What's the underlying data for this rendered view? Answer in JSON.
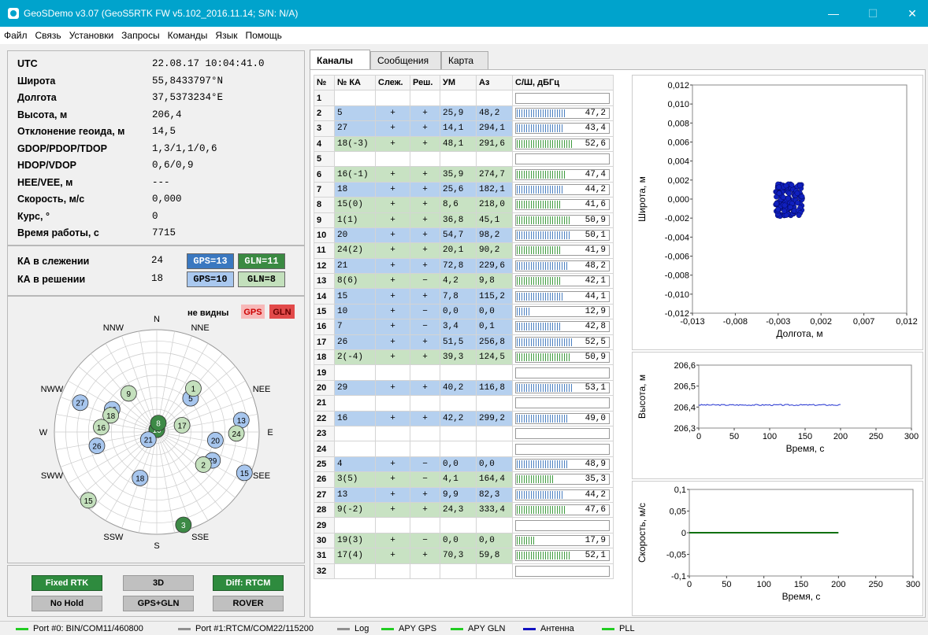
{
  "window": {
    "title": "GeoSDemo v3.07 (GeoS5RTK FW v5.102_2016.11.14; S/N: N/A)",
    "minimize": "—",
    "maximize": "☐",
    "close": "✕"
  },
  "menu": [
    "Файл",
    "Связь",
    "Установки",
    "Запросы",
    "Команды",
    "Язык",
    "Помощь"
  ],
  "info": [
    {
      "label": "UTC",
      "value": "22.08.17 10:04:41.0"
    },
    {
      "label": "Широта",
      "value": "55,8433797°N"
    },
    {
      "label": "Долгота",
      "value": "37,5373234°E"
    },
    {
      "label": "Высота, м",
      "value": "206,4"
    },
    {
      "label": "Отклонение геоида, м",
      "value": "14,5"
    },
    {
      "label": "GDOP/PDOP/TDOP",
      "value": "1,3/1,1/0,6"
    },
    {
      "label": "HDOP/VDOP",
      "value": "0,6/0,9"
    },
    {
      "label": "HEE/VEE, м",
      "value": "---"
    },
    {
      "label": "Скорость, м/с",
      "value": "0,000"
    },
    {
      "label": "Курс, °",
      "value": "0"
    },
    {
      "label": "Время работы, с",
      "value": "7715"
    }
  ],
  "sats": {
    "tracking_label": "КА в слежении",
    "tracking_value": "24",
    "tracking_gps": "GPS=13",
    "tracking_gln": "GLN=11",
    "solution_label": "КА в решении",
    "solution_value": "18",
    "solution_gps": "GPS=10",
    "solution_gln": "GLN=8"
  },
  "skyplot": {
    "not_visible": "не видны",
    "gps_tag": "GPS",
    "gln_tag": "GLN",
    "directions": [
      {
        "t": "N",
        "a": 0
      },
      {
        "t": "NNE",
        "a": 22.5
      },
      {
        "t": "NEE",
        "a": 67.5
      },
      {
        "t": "E",
        "a": 90
      },
      {
        "t": "SEE",
        "a": 112.5
      },
      {
        "t": "SSE",
        "a": 157.5
      },
      {
        "t": "S",
        "a": 180
      },
      {
        "t": "SSW",
        "a": 202.5
      },
      {
        "t": "SWW",
        "a": 247.5
      },
      {
        "t": "W",
        "a": 270
      },
      {
        "t": "NWW",
        "a": 292.5
      },
      {
        "t": "NNW",
        "a": 337.5
      }
    ],
    "colors": {
      "gps_solution": "#a7c6ee",
      "gln_solution": "#c4e0bd",
      "gps_tracked": "#3b5fb0",
      "gln_tracked": "#3d8a46"
    },
    "satellites": [
      {
        "id": "19",
        "sys": "gps",
        "az": 0,
        "el": 88,
        "used": false
      },
      {
        "id": "10",
        "sys": "gln",
        "az": 2,
        "el": 88,
        "used": false
      },
      {
        "id": "8",
        "sys": "gln",
        "az": 10,
        "el": 82,
        "used": false
      },
      {
        "id": "9",
        "sys": "gln",
        "az": 324,
        "el": 48,
        "used": true
      },
      {
        "id": "5",
        "sys": "gps",
        "az": 45,
        "el": 48,
        "used": true
      },
      {
        "id": "1",
        "sys": "gln",
        "az": 40,
        "el": 40,
        "used": true
      },
      {
        "id": "27",
        "sys": "gps",
        "az": 291,
        "el": 18,
        "used": true
      },
      {
        "id": "16",
        "sys": "gps",
        "az": 297,
        "el": 46,
        "used": true
      },
      {
        "id": "18",
        "sys": "gln",
        "az": 290,
        "el": 47,
        "used": true
      },
      {
        "id": "16",
        "sys": "gln",
        "az": 275,
        "el": 41,
        "used": true
      },
      {
        "id": "17",
        "sys": "gln",
        "az": 75,
        "el": 67,
        "used": true
      },
      {
        "id": "13",
        "sys": "gps",
        "az": 82,
        "el": 15,
        "used": true
      },
      {
        "id": "24",
        "sys": "gln",
        "az": 91,
        "el": 20,
        "used": true
      },
      {
        "id": "26",
        "sys": "gps",
        "az": 257,
        "el": 36,
        "used": true
      },
      {
        "id": "21",
        "sys": "gps",
        "az": 228,
        "el": 80,
        "used": true
      },
      {
        "id": "20",
        "sys": "gps",
        "az": 98,
        "el": 38,
        "used": true
      },
      {
        "id": "29",
        "sys": "gps",
        "az": 117,
        "el": 35,
        "used": true
      },
      {
        "id": "2",
        "sys": "gln",
        "az": 125,
        "el": 40,
        "used": true
      },
      {
        "id": "15",
        "sys": "gps",
        "az": 115,
        "el": 5,
        "used": true
      },
      {
        "id": "15",
        "sys": "gln",
        "az": 225,
        "el": 5,
        "used": true
      },
      {
        "id": "18",
        "sys": "gps",
        "az": 200,
        "el": 47,
        "used": true
      },
      {
        "id": "3",
        "sys": "gln",
        "az": 164,
        "el": 5,
        "used": false
      }
    ]
  },
  "status_buttons": [
    "Fixed RTK",
    "3D",
    "Diff: RTCM",
    "No Hold",
    "GPS+GLN",
    "ROVER"
  ],
  "tabs": [
    "Каналы",
    "Сообщения",
    "Карта"
  ],
  "channels": {
    "headers": [
      "№",
      "№ КА",
      "Слеж.",
      "Реш.",
      "УМ",
      "Аз",
      "С/Ш, дБГц"
    ],
    "rows": [
      {
        "n": "1",
        "sys": ""
      },
      {
        "n": "2",
        "sys": "gps",
        "ka": "5",
        "track": "+",
        "sol": "+",
        "el": "25,9",
        "az": "48,2",
        "snr": "47,2"
      },
      {
        "n": "3",
        "sys": "gps",
        "ka": "27",
        "track": "+",
        "sol": "+",
        "el": "14,1",
        "az": "294,1",
        "snr": "43,4"
      },
      {
        "n": "4",
        "sys": "gln",
        "ka": "18(-3)",
        "track": "+",
        "sol": "+",
        "el": "48,1",
        "az": "291,6",
        "snr": "52,6"
      },
      {
        "n": "5",
        "sys": ""
      },
      {
        "n": "6",
        "sys": "gln",
        "ka": "16(-1)",
        "track": "+",
        "sol": "+",
        "el": "35,9",
        "az": "274,7",
        "snr": "47,4"
      },
      {
        "n": "7",
        "sys": "gps",
        "ka": "18",
        "track": "+",
        "sol": "+",
        "el": "25,6",
        "az": "182,1",
        "snr": "44,2"
      },
      {
        "n": "8",
        "sys": "gln",
        "ka": "15(0)",
        "track": "+",
        "sol": "+",
        "el": "8,6",
        "az": "218,0",
        "snr": "41,6"
      },
      {
        "n": "9",
        "sys": "gln",
        "ka": "1(1)",
        "track": "+",
        "sol": "+",
        "el": "36,8",
        "az": "45,1",
        "snr": "50,9"
      },
      {
        "n": "10",
        "sys": "gps",
        "ka": "20",
        "track": "+",
        "sol": "+",
        "el": "54,7",
        "az": "98,2",
        "snr": "50,1"
      },
      {
        "n": "11",
        "sys": "gln",
        "ka": "24(2)",
        "track": "+",
        "sol": "+",
        "el": "20,1",
        "az": "90,2",
        "snr": "41,9"
      },
      {
        "n": "12",
        "sys": "gps",
        "ka": "21",
        "track": "+",
        "sol": "+",
        "el": "72,8",
        "az": "229,6",
        "snr": "48,2"
      },
      {
        "n": "13",
        "sys": "gln",
        "ka": "8(6)",
        "track": "+",
        "sol": "−",
        "el": "4,2",
        "az": "9,8",
        "snr": "42,1"
      },
      {
        "n": "14",
        "sys": "gps",
        "ka": "15",
        "track": "+",
        "sol": "+",
        "el": "7,8",
        "az": "115,2",
        "snr": "44,1"
      },
      {
        "n": "15",
        "sys": "gps",
        "ka": "10",
        "track": "+",
        "sol": "−",
        "el": "0,0",
        "az": "0,0",
        "snr": "12,9"
      },
      {
        "n": "16",
        "sys": "gps",
        "ka": "7",
        "track": "+",
        "sol": "−",
        "el": "3,4",
        "az": "0,1",
        "snr": "42,8"
      },
      {
        "n": "17",
        "sys": "gps",
        "ka": "26",
        "track": "+",
        "sol": "+",
        "el": "51,5",
        "az": "256,8",
        "snr": "52,5"
      },
      {
        "n": "18",
        "sys": "gln",
        "ka": "2(-4)",
        "track": "+",
        "sol": "+",
        "el": "39,3",
        "az": "124,5",
        "snr": "50,9"
      },
      {
        "n": "19",
        "sys": ""
      },
      {
        "n": "20",
        "sys": "gps",
        "ka": "29",
        "track": "+",
        "sol": "+",
        "el": "40,2",
        "az": "116,8",
        "snr": "53,1"
      },
      {
        "n": "21",
        "sys": ""
      },
      {
        "n": "22",
        "sys": "gps",
        "ka": "16",
        "track": "+",
        "sol": "+",
        "el": "42,2",
        "az": "299,2",
        "snr": "49,0"
      },
      {
        "n": "23",
        "sys": ""
      },
      {
        "n": "24",
        "sys": ""
      },
      {
        "n": "25",
        "sys": "gps",
        "ka": "4",
        "track": "+",
        "sol": "−",
        "el": "0,0",
        "az": "0,0",
        "snr": "48,9"
      },
      {
        "n": "26",
        "sys": "gln",
        "ka": "3(5)",
        "track": "+",
        "sol": "−",
        "el": "4,1",
        "az": "164,4",
        "snr": "35,3"
      },
      {
        "n": "27",
        "sys": "gps",
        "ka": "13",
        "track": "+",
        "sol": "+",
        "el": "9,9",
        "az": "82,3",
        "snr": "44,2"
      },
      {
        "n": "28",
        "sys": "gln",
        "ka": "9(-2)",
        "track": "+",
        "sol": "+",
        "el": "24,3",
        "az": "333,4",
        "snr": "47,6"
      },
      {
        "n": "29",
        "sys": ""
      },
      {
        "n": "30",
        "sys": "gln",
        "ka": "19(3)",
        "track": "+",
        "sol": "−",
        "el": "0,0",
        "az": "0,0",
        "snr": "17,9"
      },
      {
        "n": "31",
        "sys": "gln",
        "ka": "17(4)",
        "track": "+",
        "sol": "+",
        "el": "70,3",
        "az": "59,8",
        "snr": "52,1"
      },
      {
        "n": "32",
        "sys": ""
      }
    ]
  },
  "plots": {
    "position": {
      "ylabel": "Широта, м",
      "xlabel": "Долгота, м",
      "yticks": [
        "0,012",
        "0,010",
        "0,008",
        "0,006",
        "0,004",
        "0,002",
        "0,000",
        "-0,002",
        "-0,004",
        "-0,006",
        "-0,008",
        "-0,010",
        "-0,012"
      ],
      "xticks": [
        "-0,013",
        "-0,008",
        "-0,003",
        "0,002",
        "0,007",
        "0,012"
      ],
      "point_color": "#1020c0"
    },
    "height": {
      "ylabel": "Высота, м",
      "xlabel": "Время, с",
      "yticks": [
        "206,6",
        "206,5",
        "206,4",
        "206,3"
      ],
      "xticks": [
        "0",
        "50",
        "100",
        "150",
        "200",
        "250",
        "300"
      ],
      "line_color": "#2030d0",
      "value": 206.41,
      "t_end": 200
    },
    "speed": {
      "ylabel": "Скорость, м/с",
      "xlabel": "Время, с",
      "yticks": [
        "0,1",
        "0,05",
        "0",
        "-0,05",
        "-0,1"
      ],
      "xticks": [
        "0",
        "50",
        "100",
        "150",
        "200",
        "250",
        "300"
      ],
      "line_color": "#107010",
      "value": 0,
      "t_end": 200
    }
  },
  "statusbar": [
    {
      "text": "Port #0: BIN/COM11/460800",
      "color": "#22cc22"
    },
    {
      "text": "Port #1:RTCM/COM22/115200",
      "color": "#909090"
    },
    {
      "text": "Log",
      "color": "#909090"
    },
    {
      "text": "APY GPS",
      "color": "#22cc22"
    },
    {
      "text": "APY GLN",
      "color": "#22cc22"
    },
    {
      "text": "Антенна",
      "color": "#1010c0"
    },
    {
      "text": "PLL",
      "color": "#22cc22"
    }
  ]
}
